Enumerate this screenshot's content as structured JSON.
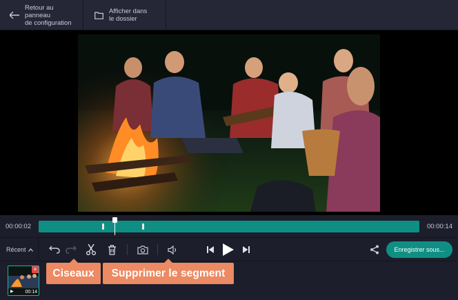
{
  "toolbar": {
    "back_label": "Retour au panneau\nde configuration",
    "folder_label": "Afficher dans\nle dossier"
  },
  "timeline": {
    "current_time": "00:00:02",
    "total_time": "00:00:14",
    "playhead_fraction": 0.199,
    "marker_fractions": [
      0.167,
      0.271
    ]
  },
  "controls": {
    "recent_label": "Récent",
    "save_label": "Enregistrer sous...",
    "icons": [
      "undo-icon",
      "redo-icon",
      "scissors-icon",
      "trash-icon",
      "camera-icon",
      "volume-icon",
      "previous-frame-icon",
      "play-icon",
      "next-frame-icon",
      "share-icon"
    ]
  },
  "clip": {
    "duration": "00:14"
  },
  "callouts": {
    "scissors": "Ciseaux",
    "delete": "Supprimer le segment"
  },
  "colors": {
    "accent": "#0f8f84",
    "callout": "#ec8a63",
    "background": "#1c1e2b"
  }
}
